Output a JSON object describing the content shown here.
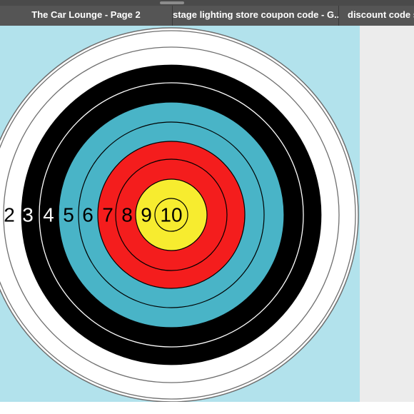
{
  "browser": {
    "tabs": [
      {
        "title": "The Car Lounge - Page 2"
      },
      {
        "title": "stage lighting store coupon code - G..."
      },
      {
        "title": "discount code sol"
      }
    ]
  },
  "target": {
    "ring_labels": [
      "2",
      "3",
      "4",
      "5",
      "6",
      "7",
      "8",
      "9",
      "10"
    ],
    "colors": {
      "background": "#b2e2ec",
      "white_ring": "#ffffff",
      "black_ring": "#000000",
      "blue_ring": "#49b4c7",
      "red_ring": "#f41d1d",
      "yellow_ring": "#f7ec2f",
      "outline": "#6f6f6f"
    }
  }
}
